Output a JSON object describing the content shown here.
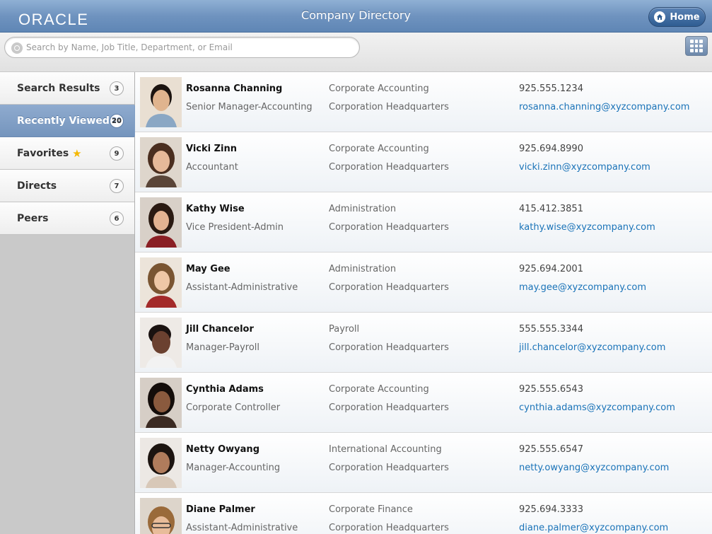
{
  "header": {
    "logo": "ORACLE",
    "title": "Company Directory",
    "home_label": "Home"
  },
  "search": {
    "placeholder": "Search by Name, Job Title, Department, or Email"
  },
  "sidebar": {
    "items": [
      {
        "label": "Search Results",
        "count": "3"
      },
      {
        "label": "Recently Viewed",
        "count": "20"
      },
      {
        "label": "Favorites",
        "count": "9"
      },
      {
        "label": "Directs",
        "count": "7"
      },
      {
        "label": "Peers",
        "count": "6"
      }
    ]
  },
  "people": [
    {
      "name": "Rosanna Channing",
      "title": "Senior Manager-Accounting",
      "department": "Corporate Accounting",
      "location": "Corporation Headquarters",
      "phone": "925.555.1234",
      "email": "rosanna.channing@xyzcompany.com"
    },
    {
      "name": "Vicki Zinn",
      "title": "Accountant",
      "department": "Corporate Accounting",
      "location": "Corporation Headquarters",
      "phone": "925.694.8990",
      "email": "vicki.zinn@xyzcompany.com"
    },
    {
      "name": "Kathy Wise",
      "title": "Vice President-Admin",
      "department": "Administration",
      "location": "Corporation Headquarters",
      "phone": "415.412.3851",
      "email": "kathy.wise@xyzcompany.com"
    },
    {
      "name": "May Gee",
      "title": "Assistant-Administrative",
      "department": "Administration",
      "location": "Corporation Headquarters",
      "phone": "925.694.2001",
      "email": "may.gee@xyzcompany.com"
    },
    {
      "name": "Jill Chancelor",
      "title": "Manager-Payroll",
      "department": "Payroll",
      "location": "Corporation Headquarters",
      "phone": "555.555.3344",
      "email": "jill.chancelor@xyzcompany.com"
    },
    {
      "name": "Cynthia Adams",
      "title": "Corporate Controller",
      "department": "Corporate Accounting",
      "location": "Corporation Headquarters",
      "phone": "925.555.6543",
      "email": "cynthia.adams@xyzcompany.com"
    },
    {
      "name": "Netty Owyang",
      "title": "Manager-Accounting",
      "department": "International Accounting",
      "location": "Corporation Headquarters",
      "phone": "925.555.6547",
      "email": "netty.owyang@xyzcompany.com"
    },
    {
      "name": "Diane Palmer",
      "title": "Assistant-Administrative",
      "department": "Corporate Finance",
      "location": "Corporation Headquarters",
      "phone": "925.694.3333",
      "email": "diane.palmer@xyzcompany.com"
    }
  ],
  "colors": {
    "header": "#6f93bf",
    "selected_nav": "#7f9ec4",
    "email_link": "#1a73b8"
  }
}
